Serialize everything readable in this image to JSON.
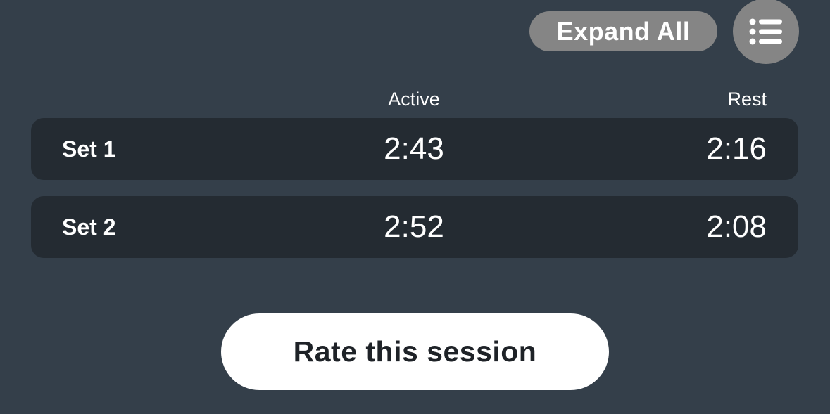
{
  "toolbar": {
    "expand_label": "Expand All",
    "menu_icon": "list-icon"
  },
  "table": {
    "columns": [
      "Active",
      "Rest"
    ],
    "rows": [
      {
        "label": "Set 1",
        "active": "2:43",
        "rest": "2:16"
      },
      {
        "label": "Set 2",
        "active": "2:52",
        "rest": "2:08"
      }
    ]
  },
  "actions": {
    "rate_label": "Rate this session"
  },
  "colors": {
    "background": "#343f4a",
    "row_background": "#242b32",
    "pill_button": "#858585",
    "primary_button": "#ffffff",
    "primary_button_text": "#1e2227"
  }
}
